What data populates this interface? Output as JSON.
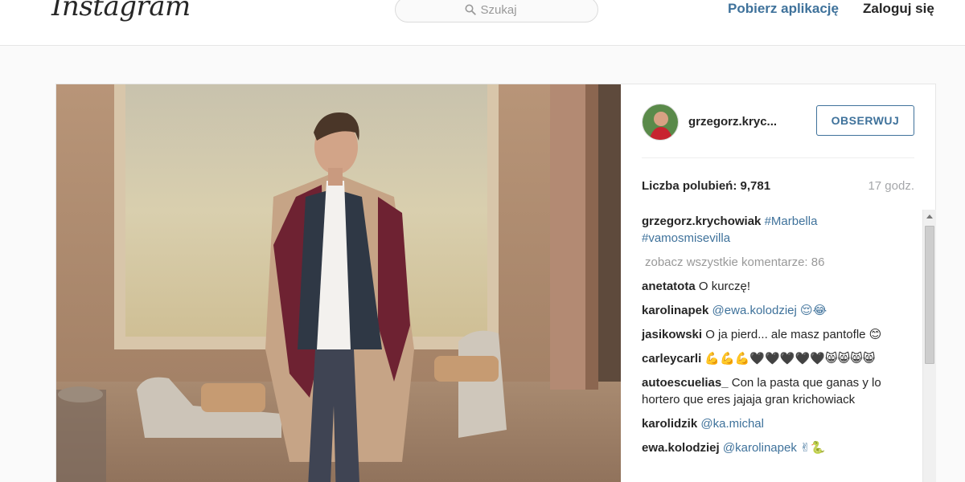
{
  "header": {
    "logo_text": "Instagram",
    "search_placeholder": "Szukaj",
    "get_app_label": "Pobierz aplikację",
    "login_label": "Zaloguj się"
  },
  "post": {
    "username": "grzegorz.kryc...",
    "follow_label": "OBSERWUJ",
    "likes_label": "Liczba polubień:",
    "likes_count": "9,781",
    "time": "17 godz.",
    "caption": {
      "user": "grzegorz.krychowiak",
      "text": "#Marbella #vamosmisevilla"
    },
    "view_all": "zobacz wszystkie komentarze: 86",
    "comments": [
      {
        "user": "anetatota",
        "text": "O kurczę!"
      },
      {
        "user": "karolinapek",
        "text": "@ewa.kolodziej 😌😂"
      },
      {
        "user": "jasikowski",
        "text": "O ja pierd... ale masz pantofle 😊"
      },
      {
        "user": "carleycarli",
        "text": "💪💪💪🖤🖤🖤🖤🖤😸😸😸😸"
      },
      {
        "user": "autoescuelias_",
        "text": "Con la pasta que ganas y lo hortero que eres jajaja gran krichowiack"
      },
      {
        "user": "karolidzik",
        "text": "@ka.michal"
      },
      {
        "user": "ewa.kolodziej",
        "text": "@karolinapek ✌🐍"
      }
    ]
  },
  "colors": {
    "link_blue": "#3f729b",
    "muted": "#999999",
    "border": "#e6e6e6"
  }
}
